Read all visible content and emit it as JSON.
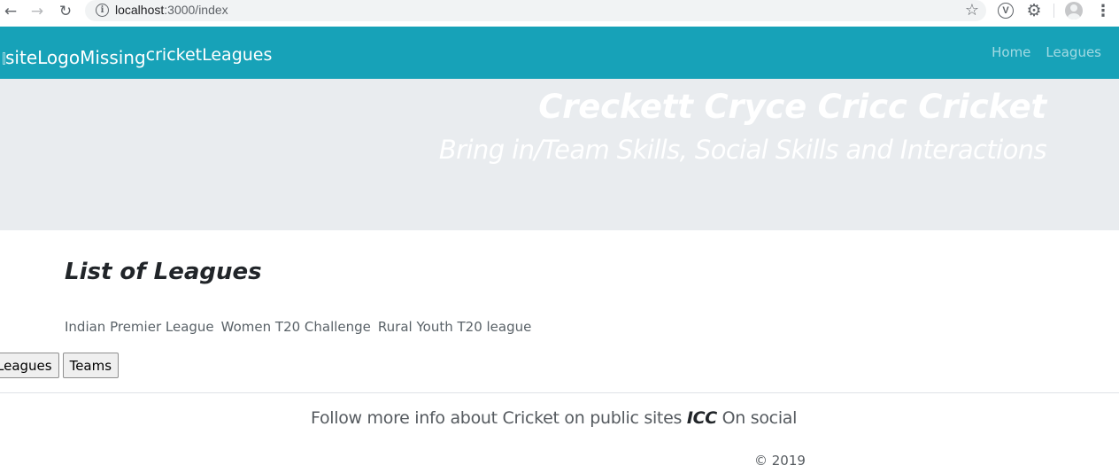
{
  "browser": {
    "url_host": "localhost",
    "url_rest": ":3000/index"
  },
  "site": {
    "logo_alt": "siteLogoMissing",
    "brand_name": "cricketLeagues",
    "nav": [
      {
        "label": "Home"
      },
      {
        "label": "Leagues"
      }
    ],
    "accent_color": "#17a2b8"
  },
  "hero": {
    "title": "Creckett Cryce Cricc Cricket",
    "subtitle": "Bring in/Team Skills, Social Skills and Interactions"
  },
  "main": {
    "heading": "List of Leagues",
    "leagues": [
      "Indian Premier League",
      "Women T20 Challenge",
      "Rural Youth T20 league"
    ],
    "buttons": [
      {
        "label": "Leagues"
      },
      {
        "label": "Teams"
      }
    ]
  },
  "footer": {
    "text_before": "Follow more info about Cricket on public sites ",
    "brand": "ICC",
    "text_after": " On social",
    "copyright": "© 2019"
  }
}
